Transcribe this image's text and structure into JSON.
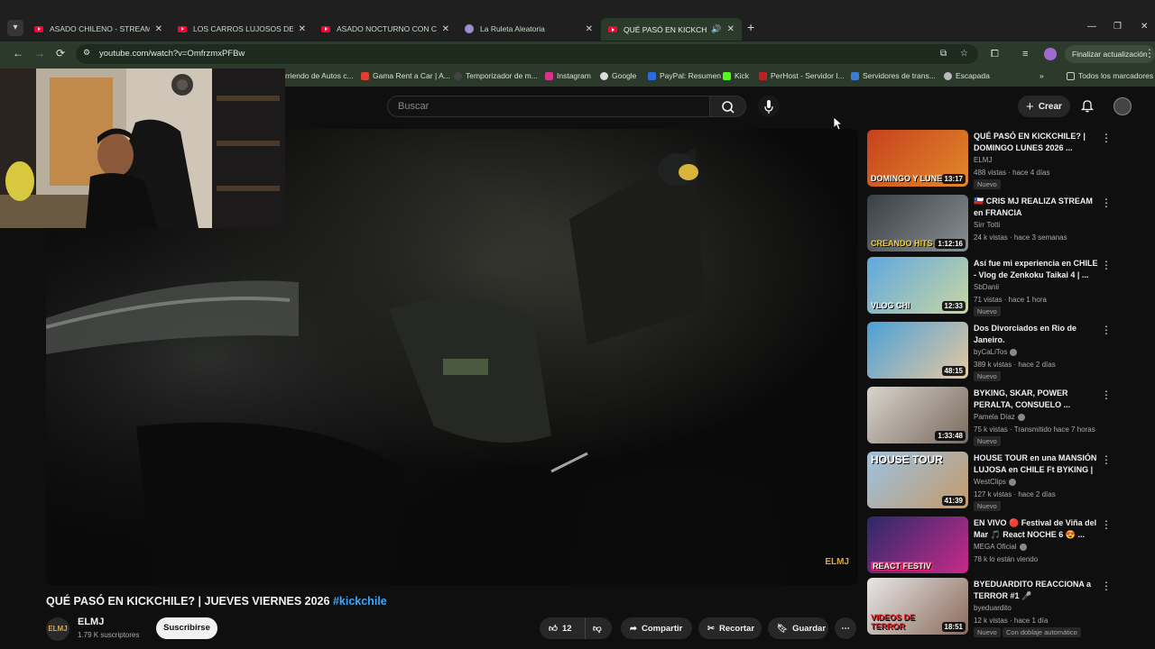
{
  "browser": {
    "tabs": [
      {
        "title": "ASADO CHILENO - STREAM CO",
        "icon": "youtube-icon"
      },
      {
        "title": "LOS CARROS LUJOSOS DE CRIS",
        "icon": "youtube-icon"
      },
      {
        "title": "ASADO NOCTURNO CON CRIS",
        "icon": "youtube-icon"
      },
      {
        "title": "La Ruleta Aleatoria",
        "icon": "globe-icon"
      },
      {
        "title": "QUÉ PASÓ EN KICKCHILE? |",
        "icon": "youtube-icon"
      }
    ],
    "url": "youtube.com/watch?v=OmfrzmxPFBw",
    "update_button": "Finalizar actualización",
    "bookmarks": [
      "rriendo de Autos c...",
      "Gama Rent a Car | A...",
      "Temporizador de m...",
      "Instagram",
      "Google",
      "PayPal: Resumen",
      "Kick",
      "PerHost - Servidor I...",
      "Servidores de trans...",
      "Escapada"
    ],
    "all_bookmarks": "Todos los marcadores",
    "colors": {
      "frame": "#1f1f1f",
      "toolbar": "#2b3a2b",
      "accent": "#ff0033"
    }
  },
  "youtube": {
    "search_placeholder": "Buscar",
    "create_label": "Crear",
    "video": {
      "title": "QUÉ PASÓ EN KICKCHILE? | JUEVES VIERNES 2026",
      "hashtag": "#kickchile",
      "watermark": "ELMJ",
      "channel": "ELMJ",
      "subscribers": "1.79 K suscriptores",
      "subscribe_label": "Suscribirse",
      "likes": "12",
      "share_label": "Compartir",
      "clip_label": "Recortar",
      "save_label": "Guardar"
    },
    "recommendations": [
      {
        "title": "QUÉ PASÓ EN KICKCHILE? | DOMINGO LUNES 2026 ...",
        "channel": "ELMJ",
        "meta": "488 vistas · hace 4 días",
        "badge": "Nuevo",
        "duration": "13:17",
        "thumb_text": "DOMINGO Y LUNES",
        "verified": false
      },
      {
        "title": "🇨🇱 CRIS MJ REALIZA STREAM en FRANCIA",
        "channel": "Sirr Totti",
        "meta": "24 k vistas · hace 3 semanas",
        "badge": "",
        "duration": "1:12:16",
        "thumb_text": "CREANDO HITS EN",
        "verified": false
      },
      {
        "title": "Así fue mi experiencia en CHILE - Vlog de Zenkoku Taikai 4 | ...",
        "channel": "SbDanii",
        "meta": "71 vistas · hace 1 hora",
        "badge": "Nuevo",
        "duration": "12:33",
        "thumb_text": "VLOG CHI",
        "verified": false
      },
      {
        "title": "Dos Divorciados en Rio de Janeiro.",
        "channel": "byCaLiTos",
        "meta": "389 k vistas · hace 2 días",
        "badge": "Nuevo",
        "duration": "48:15",
        "thumb_text": "",
        "verified": true
      },
      {
        "title": "BYKING, SKAR, POWER PERALTA, CONSUELO ...",
        "channel": "Pamela Díaz",
        "meta": "75 k vistas · Transmitido hace 7 horas",
        "badge": "Nuevo",
        "duration": "1:33:48",
        "thumb_text": "",
        "verified": true
      },
      {
        "title": "HOUSE TOUR en una MANSIÓN LUJOSA en CHILE Ft BYKING | ...",
        "channel": "WestClips",
        "meta": "127 k vistas · hace 2 días",
        "badge": "Nuevo",
        "duration": "41:39",
        "thumb_text": "HOUSE TOUR",
        "verified": true
      },
      {
        "title": "EN VIVO 🔴 Festival de Viña del Mar 🎵 React NOCHE 6 😍 ...",
        "channel": "MEGA Oficial",
        "meta": "78 k lo están viendo",
        "badge": "",
        "duration": "",
        "thumb_text": "REACT FESTIV",
        "verified": true
      },
      {
        "title": "BYEDUARDITO REACCIONA a TERROR #1 🎤",
        "channel": "byeduardito",
        "meta": "12 k vistas · hace 1 día",
        "badge": "Nuevo",
        "badge2": "Con doblaje automático",
        "duration": "18:51",
        "thumb_text": "VIDEOS DE TERROR",
        "verified": false
      }
    ]
  }
}
